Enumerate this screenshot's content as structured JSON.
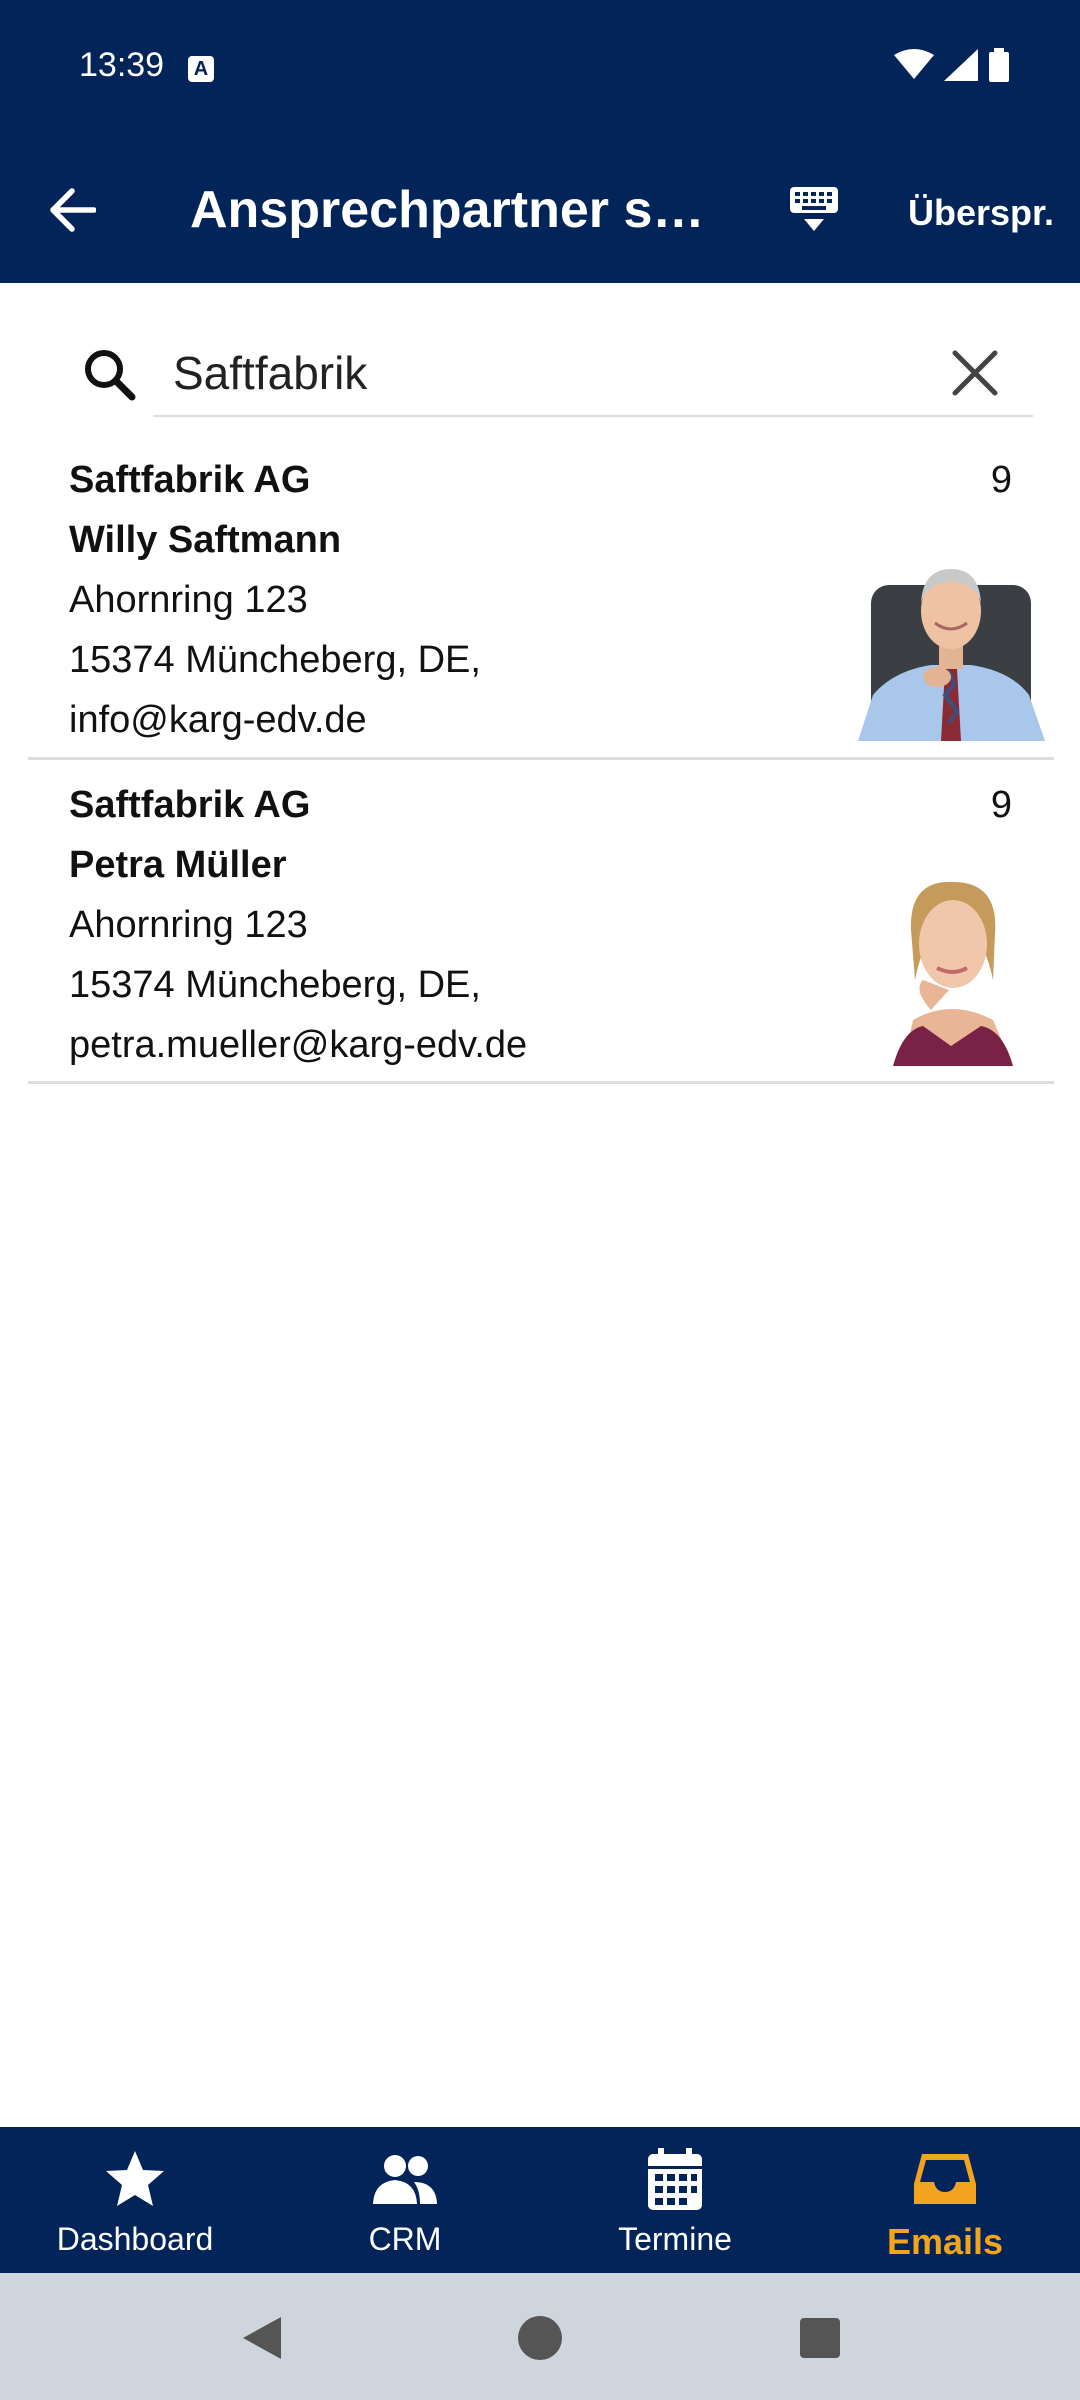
{
  "status_bar": {
    "time": "13:39",
    "badge": "A"
  },
  "app_bar": {
    "title": "Ansprechpartner su...",
    "skip_label": "Überspr."
  },
  "search": {
    "value": "Saftfabrik",
    "placeholder": ""
  },
  "results": [
    {
      "company": "Saftfabrik AG",
      "name": "Willy Saftmann",
      "street": "Ahornring 123",
      "city": "15374 Müncheberg, DE,",
      "email": "info@karg-edv.de",
      "count": "9"
    },
    {
      "company": "Saftfabrik AG",
      "name": "Petra Müller",
      "street": "Ahornring 123",
      "city": "15374 Müncheberg, DE,",
      "email": "petra.mueller@karg-edv.de",
      "count": "9"
    }
  ],
  "bottom_nav": [
    {
      "label": "Dashboard",
      "icon": "star-icon"
    },
    {
      "label": "CRM",
      "icon": "people-icon"
    },
    {
      "label": "Termine",
      "icon": "calendar-icon"
    },
    {
      "label": "Emails",
      "icon": "inbox-icon",
      "active": true
    }
  ],
  "colors": {
    "primary": "#022459",
    "accent": "#f2a51c"
  }
}
